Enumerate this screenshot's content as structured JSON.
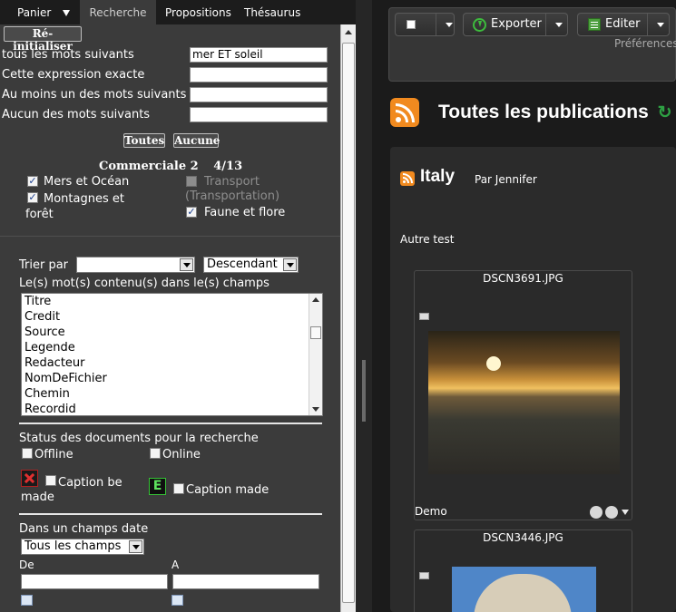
{
  "tabs": [
    {
      "label": "Panier"
    },
    {
      "label": "Recherche"
    },
    {
      "label": "Propositions"
    },
    {
      "label": "Thésaurus"
    }
  ],
  "search": {
    "reset_label": "Ré-initialiser",
    "fields": [
      {
        "label": "tous les mots suivants",
        "value": "mer ET soleil"
      },
      {
        "label": "Cette expression exacte",
        "value": ""
      },
      {
        "label": "Au moins un des mots suivants",
        "value": ""
      },
      {
        "label": "Aucun des mots suivants",
        "value": ""
      }
    ],
    "all_label": "Toutes",
    "none_label": "Aucune",
    "collection": {
      "name": "Commerciale 2",
      "count": "4/13"
    },
    "categories": [
      {
        "label": "Mers et Océan",
        "checked": true,
        "enabled": true
      },
      {
        "label": "Transport (Transportation)",
        "checked": false,
        "enabled": false
      },
      {
        "label": "Montagnes et forêt",
        "checked": true,
        "enabled": true
      },
      {
        "label": "Faune et flore",
        "checked": true,
        "enabled": true
      }
    ],
    "sort_label": "Trier par",
    "sort_field": "",
    "sort_order": "Descendant",
    "fields_label": "Le(s) mot(s) contenu(s) dans le(s) champs",
    "field_list": [
      "Titre",
      "Credit",
      "Source",
      "Legende",
      "Redacteur",
      "NomDeFichier",
      "Chemin",
      "Recordid"
    ],
    "status_label": "Status des documents pour la recherche",
    "status": [
      {
        "label": "Offline",
        "checked": false
      },
      {
        "label": "Online",
        "checked": false
      },
      {
        "label": "Caption be made",
        "checked": false
      },
      {
        "label": "Caption made",
        "checked": false
      }
    ],
    "date_label": "Dans un champs date",
    "date_field": "Tous les champs",
    "from_label": "De",
    "to_label": "A"
  },
  "toolbar": {
    "export_label": "Exporter",
    "edit_label": "Editer",
    "prefs_label": "Préférences"
  },
  "publications": {
    "title": "Toutes les publications",
    "feed_title": "Italy",
    "feed_author": "Par Jennifer",
    "feed_text": "Autre test",
    "items": [
      {
        "filename": "DSCN3691.JPG",
        "caption": "Demo"
      },
      {
        "filename": "DSCN3446.JPG",
        "caption": ""
      }
    ]
  },
  "colors": {
    "accent": "#f18a1f",
    "refresh": "#2ea043"
  }
}
